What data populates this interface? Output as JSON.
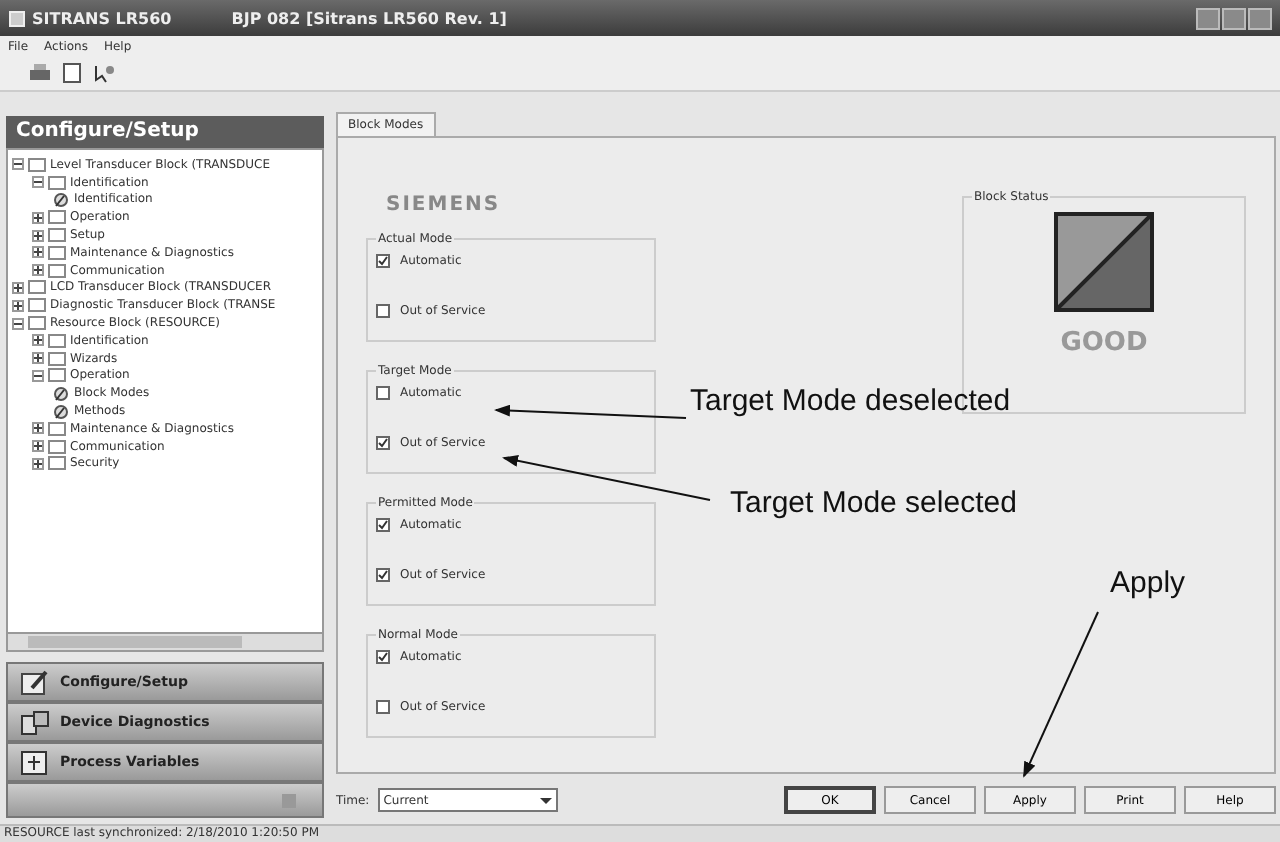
{
  "window": {
    "app": "SITRANS LR560",
    "title": "BJP 082 [Sitrans LR560 Rev. 1]"
  },
  "menu": [
    "File",
    "Actions",
    "Help"
  ],
  "sidebar": {
    "title": "Configure/Setup",
    "tree": [
      {
        "label": "Level Transducer Block (TRANSDUCE",
        "kind": "folder",
        "expanded": true,
        "children": [
          {
            "label": "Identification",
            "kind": "folder",
            "expanded": true,
            "children": [
              {
                "label": "Identification",
                "kind": "method"
              }
            ]
          },
          {
            "label": "Operation",
            "kind": "folder",
            "expanded": false
          },
          {
            "label": "Setup",
            "kind": "folder",
            "expanded": false
          },
          {
            "label": "Maintenance & Diagnostics",
            "kind": "folder",
            "expanded": false
          },
          {
            "label": "Communication",
            "kind": "folder",
            "expanded": false
          }
        ]
      },
      {
        "label": "LCD Transducer Block (TRANSDUCER",
        "kind": "folder",
        "expanded": false
      },
      {
        "label": "Diagnostic Transducer Block (TRANSE",
        "kind": "folder",
        "expanded": false
      },
      {
        "label": "Resource Block (RESOURCE)",
        "kind": "folder",
        "expanded": true,
        "children": [
          {
            "label": "Identification",
            "kind": "folder",
            "expanded": false
          },
          {
            "label": "Wizards",
            "kind": "folder",
            "expanded": false
          },
          {
            "label": "Operation",
            "kind": "folder",
            "expanded": true,
            "children": [
              {
                "label": "Block Modes",
                "kind": "method"
              },
              {
                "label": "Methods",
                "kind": "method"
              }
            ]
          },
          {
            "label": "Maintenance & Diagnostics",
            "kind": "folder",
            "expanded": false
          },
          {
            "label": "Communication",
            "kind": "folder",
            "expanded": false
          },
          {
            "label": "Security",
            "kind": "folder",
            "expanded": false
          }
        ]
      }
    ],
    "nav": [
      {
        "label": "Configure/Setup",
        "kind": "setup"
      },
      {
        "label": "Device Diagnostics",
        "kind": "diagnostics"
      },
      {
        "label": "Process Variables",
        "kind": "variables"
      }
    ]
  },
  "tabs": [
    {
      "label": "Block Modes",
      "selected": true
    }
  ],
  "logo": "SIEMENS",
  "mode_groups": [
    {
      "title": "Actual Mode",
      "options": [
        {
          "label": "Automatic",
          "checked": true
        },
        {
          "label": "Out of Service",
          "checked": false
        }
      ]
    },
    {
      "title": "Target Mode",
      "options": [
        {
          "label": "Automatic",
          "checked": false
        },
        {
          "label": "Out of Service",
          "checked": true
        }
      ]
    },
    {
      "title": "Permitted Mode",
      "options": [
        {
          "label": "Automatic",
          "checked": true
        },
        {
          "label": "Out of Service",
          "checked": true
        }
      ]
    },
    {
      "title": "Normal Mode",
      "options": [
        {
          "label": "Automatic",
          "checked": true
        },
        {
          "label": "Out of Service",
          "checked": false
        }
      ]
    }
  ],
  "block_status": {
    "title": "Block Status",
    "status": "GOOD"
  },
  "time": {
    "label": "Time:",
    "value": "Current"
  },
  "buttons": [
    {
      "label": "OK",
      "default": true
    },
    {
      "label": "Cancel",
      "default": false
    },
    {
      "label": "Apply",
      "default": false
    },
    {
      "label": "Print",
      "default": false
    },
    {
      "label": "Help",
      "default": false
    }
  ],
  "status_bar": "RESOURCE last synchronized: 2/18/2010 1:20:50 PM",
  "annotations": [
    "Target Mode deselected",
    "Target Mode selected",
    "Apply"
  ]
}
